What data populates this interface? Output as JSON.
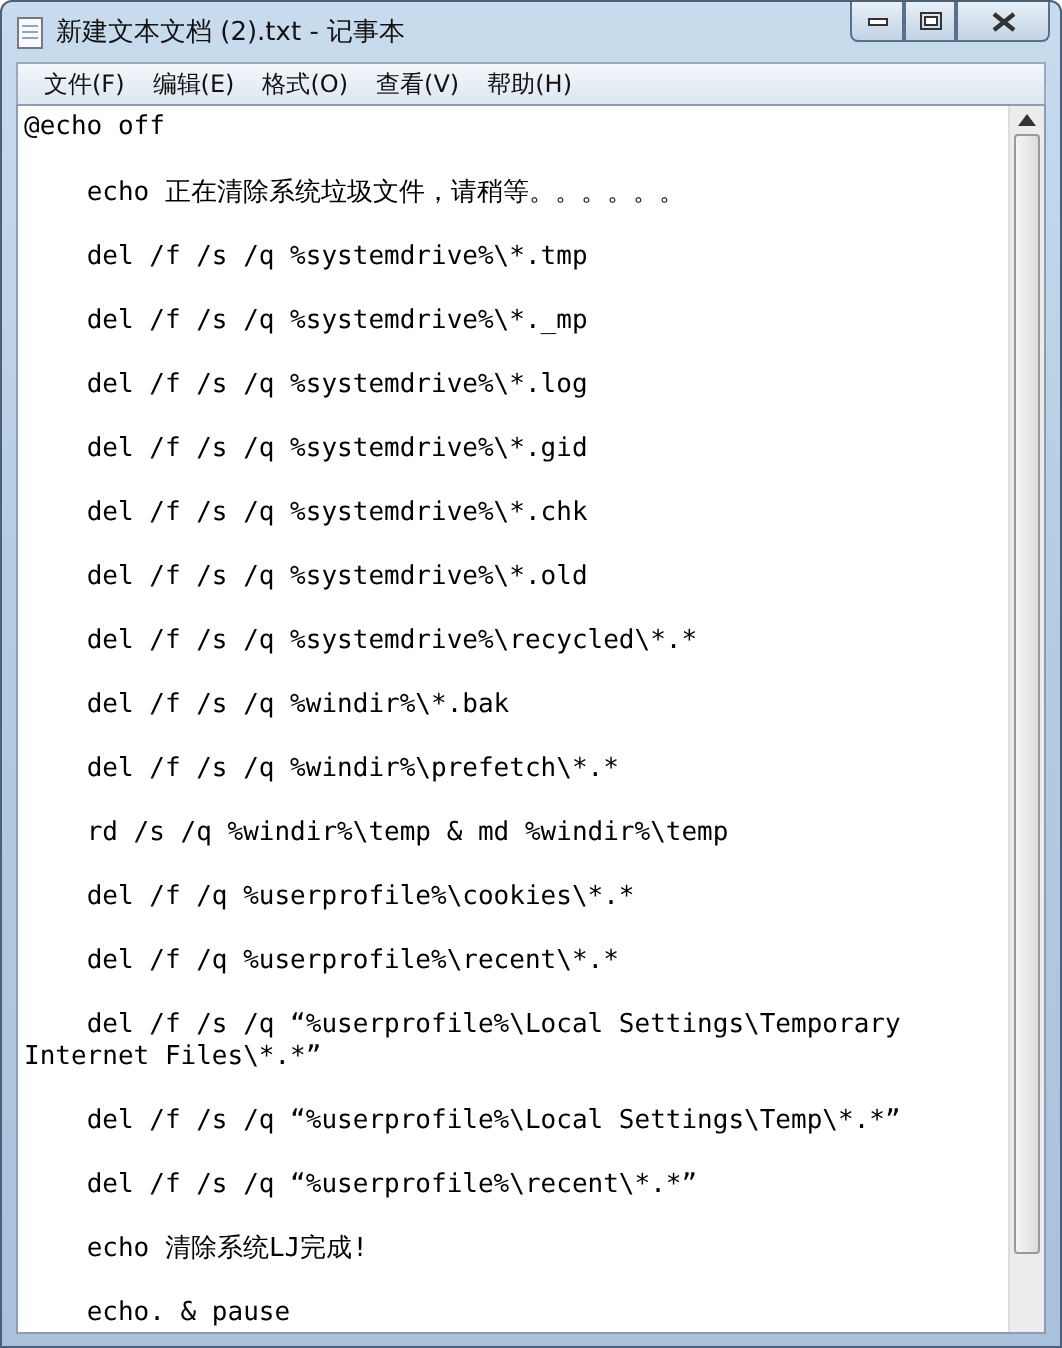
{
  "window": {
    "title": "新建文本文档 (2).txt - 记事本"
  },
  "menu": [
    "文件(F)",
    "编辑(E)",
    "格式(O)",
    "查看(V)",
    "帮助(H)"
  ],
  "lines": [
    "@echo off",
    "    echo 正在清除系统垃圾文件，请稍等。。。。。。",
    "    del /f /s /q %systemdrive%\\*.tmp",
    "    del /f /s /q %systemdrive%\\*._mp",
    "    del /f /s /q %systemdrive%\\*.log",
    "    del /f /s /q %systemdrive%\\*.gid",
    "    del /f /s /q %systemdrive%\\*.chk",
    "    del /f /s /q %systemdrive%\\*.old",
    "    del /f /s /q %systemdrive%\\recycled\\*.*",
    "    del /f /s /q %windir%\\*.bak",
    "    del /f /s /q %windir%\\prefetch\\*.*",
    "    rd /s /q %windir%\\temp & md %windir%\\temp",
    "    del /f /q %userprofile%\\cookies\\*.*",
    "    del /f /q %userprofile%\\recent\\*.*",
    "    del /f /s /q “%userprofile%\\Local Settings\\Temporary Internet Files\\*.*”",
    "    del /f /s /q “%userprofile%\\Local Settings\\Temp\\*.*”",
    "    del /f /s /q “%userprofile%\\recent\\*.*”",
    "    echo 清除系统LJ完成!",
    "    echo. & pause"
  ]
}
